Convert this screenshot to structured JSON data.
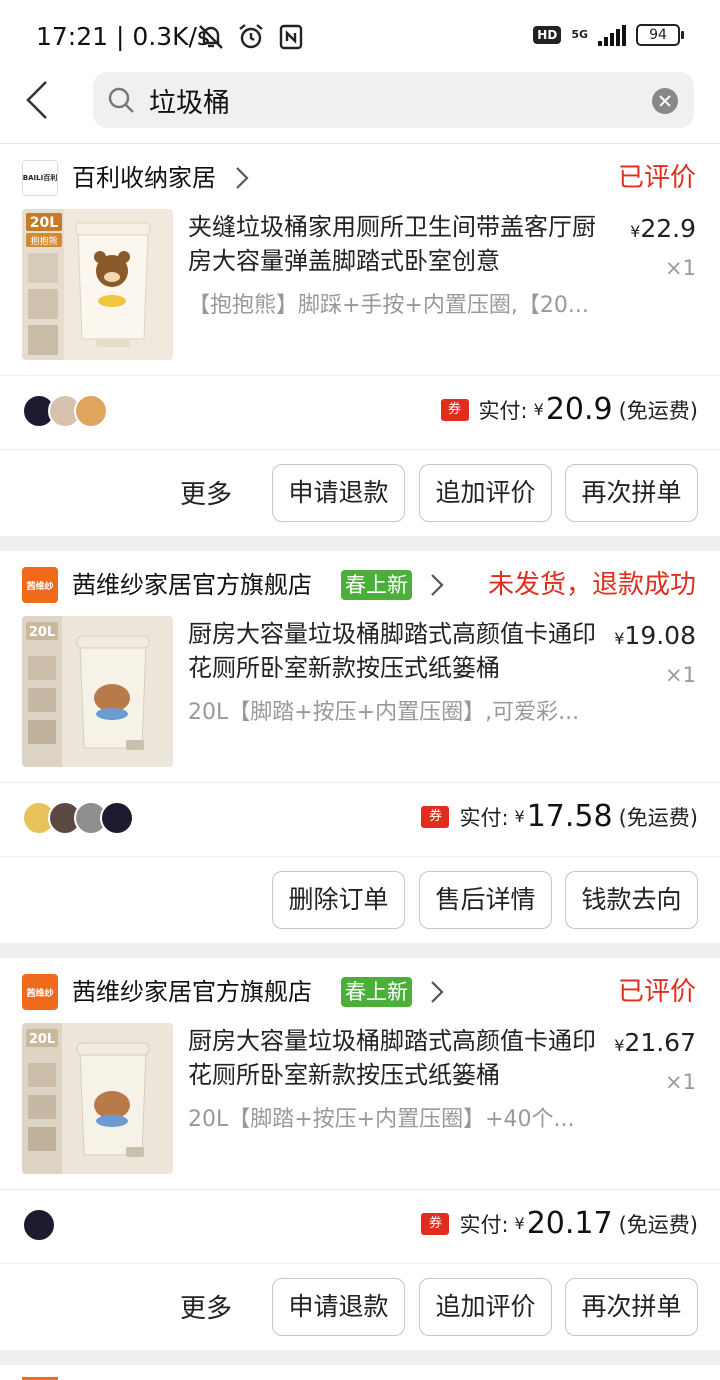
{
  "status_bar": {
    "time": "17:21 | 0.3K/s",
    "hd": "HD",
    "network": "5G",
    "battery": "94"
  },
  "search": {
    "query": "垃圾桶"
  },
  "orders": [
    {
      "shop_name": "百利收纳家居",
      "shop_logo_text": "BAILI百利",
      "shop_tag": "",
      "status": "已评价",
      "product_title": "夹缝垃圾桶家用厕所卫生间带盖客厅厨房大容量弹盖脚踏式卧室创意",
      "product_sku": "【抱抱熊】脚踩+手按+内置压圈,【20...",
      "price_symbol": "¥",
      "price": "22.9",
      "quantity": "×1",
      "image_badge": "20L",
      "image_badge_sub": "抱抱熊",
      "coupon": "券",
      "actual_label": "实付:",
      "actual_symbol": "¥",
      "actual_amount": "20.9",
      "shipping": "(免运费)",
      "more": "更多",
      "buttons": [
        "申请退款",
        "追加评价",
        "再次拼单"
      ]
    },
    {
      "shop_name": "茜维纱家居官方旗舰店",
      "shop_logo_text": "茜维纱",
      "shop_tag": "春上新",
      "status": "未发货，退款成功",
      "product_title": "厨房大容量垃圾桶脚踏式高颜值卡通印花厕所卧室新款按压式纸篓桶",
      "product_sku": "20L【脚踏+按压+内置压圈】,可爱彩...",
      "price_symbol": "¥",
      "price": "19.08",
      "quantity": "×1",
      "image_badge": "20L",
      "coupon": "券",
      "actual_label": "实付:",
      "actual_symbol": "¥",
      "actual_amount": "17.58",
      "shipping": "(免运费)",
      "buttons": [
        "删除订单",
        "售后详情",
        "钱款去向"
      ]
    },
    {
      "shop_name": "茜维纱家居官方旗舰店",
      "shop_logo_text": "茜维纱",
      "shop_tag": "春上新",
      "status": "已评价",
      "product_title": "厨房大容量垃圾桶脚踏式高颜值卡通印花厕所卧室新款按压式纸篓桶",
      "product_sku": "20L【脚踏+按压+内置压圈】+40个...",
      "price_symbol": "¥",
      "price": "21.67",
      "quantity": "×1",
      "image_badge": "20L",
      "coupon": "券",
      "actual_label": "实付:",
      "actual_symbol": "¥",
      "actual_amount": "20.17",
      "shipping": "(免运费)",
      "more": "更多",
      "buttons": [
        "申请退款",
        "追加评价",
        "再次拼单"
      ]
    }
  ],
  "colors": {
    "accent_red": "#e12d1e",
    "tag_green": "#4caf3a",
    "logo_orange": "#ef6a1b"
  }
}
